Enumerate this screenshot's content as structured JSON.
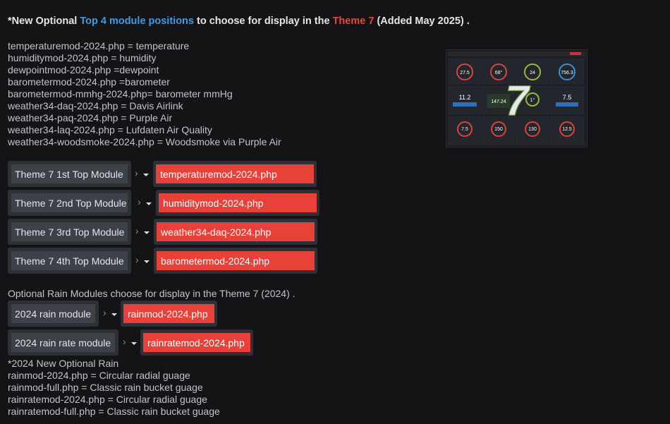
{
  "headline": {
    "prefix": "*New Optional ",
    "highlight_blue": "Top 4 module positions",
    "middle": " to choose for display in the ",
    "highlight_red": "Theme 7",
    "suffix": " (Added May 2025) ."
  },
  "module_list": [
    "temperaturemod-2024.php = temperature",
    "humiditymod-2024.php = humidity",
    "dewpointmod-2024.php =dewpoint",
    "barometermod-2024.php =barometer",
    "barometermod-mmhg-2024.php= barometer mmHg",
    "weather34-daq-2024.php = Davis Airlink",
    "weather34-paq-2024.php = Purple Air",
    "weather34-laq-2024.php = Lufdaten Air Quality",
    "weather34-woodsmoke-2024.php = Woodsmoke via Purple Air"
  ],
  "preview": {
    "big_number": "7",
    "tiles": [
      "27.5",
      "68°",
      "24",
      "756.3",
      "11.2",
      "147.24",
      "1°",
      "7.5",
      "7.5",
      "150",
      "130",
      "12.5"
    ]
  },
  "top_modules": [
    {
      "label": "Theme 7 1st Top Module",
      "value": "temperaturemod-2024.php"
    },
    {
      "label": "Theme 7 2nd Top Module",
      "value": "humiditymod-2024.php"
    },
    {
      "label": "Theme 7 3rd Top Module",
      "value": "weather34-daq-2024.php"
    },
    {
      "label": "Theme 7 4th Top Module",
      "value": "barometermod-2024.php"
    }
  ],
  "rain_heading": "Optional Rain Modules choose for display in the Theme 7 (2024) .",
  "rain_modules": [
    {
      "label": "2024 rain module",
      "value": "rainmod-2024.php"
    },
    {
      "label": "2024 rain rate module",
      "value": "rainratemod-2024.php"
    }
  ],
  "rain_notes": [
    "*2024 New Optional Rain",
    "rainmod-2024.php = Circular radial guage",
    "rainmod-full.php = Classic rain bucket guage",
    "rainratemod-2024.php = Circular radial guage",
    "rainratemod-full.php = Classic rain bucket guage"
  ],
  "colors": {
    "accent_blue": "#3f9be6",
    "accent_red": "#e8483b",
    "select_bg": "#e8413a",
    "background": "#141416"
  }
}
